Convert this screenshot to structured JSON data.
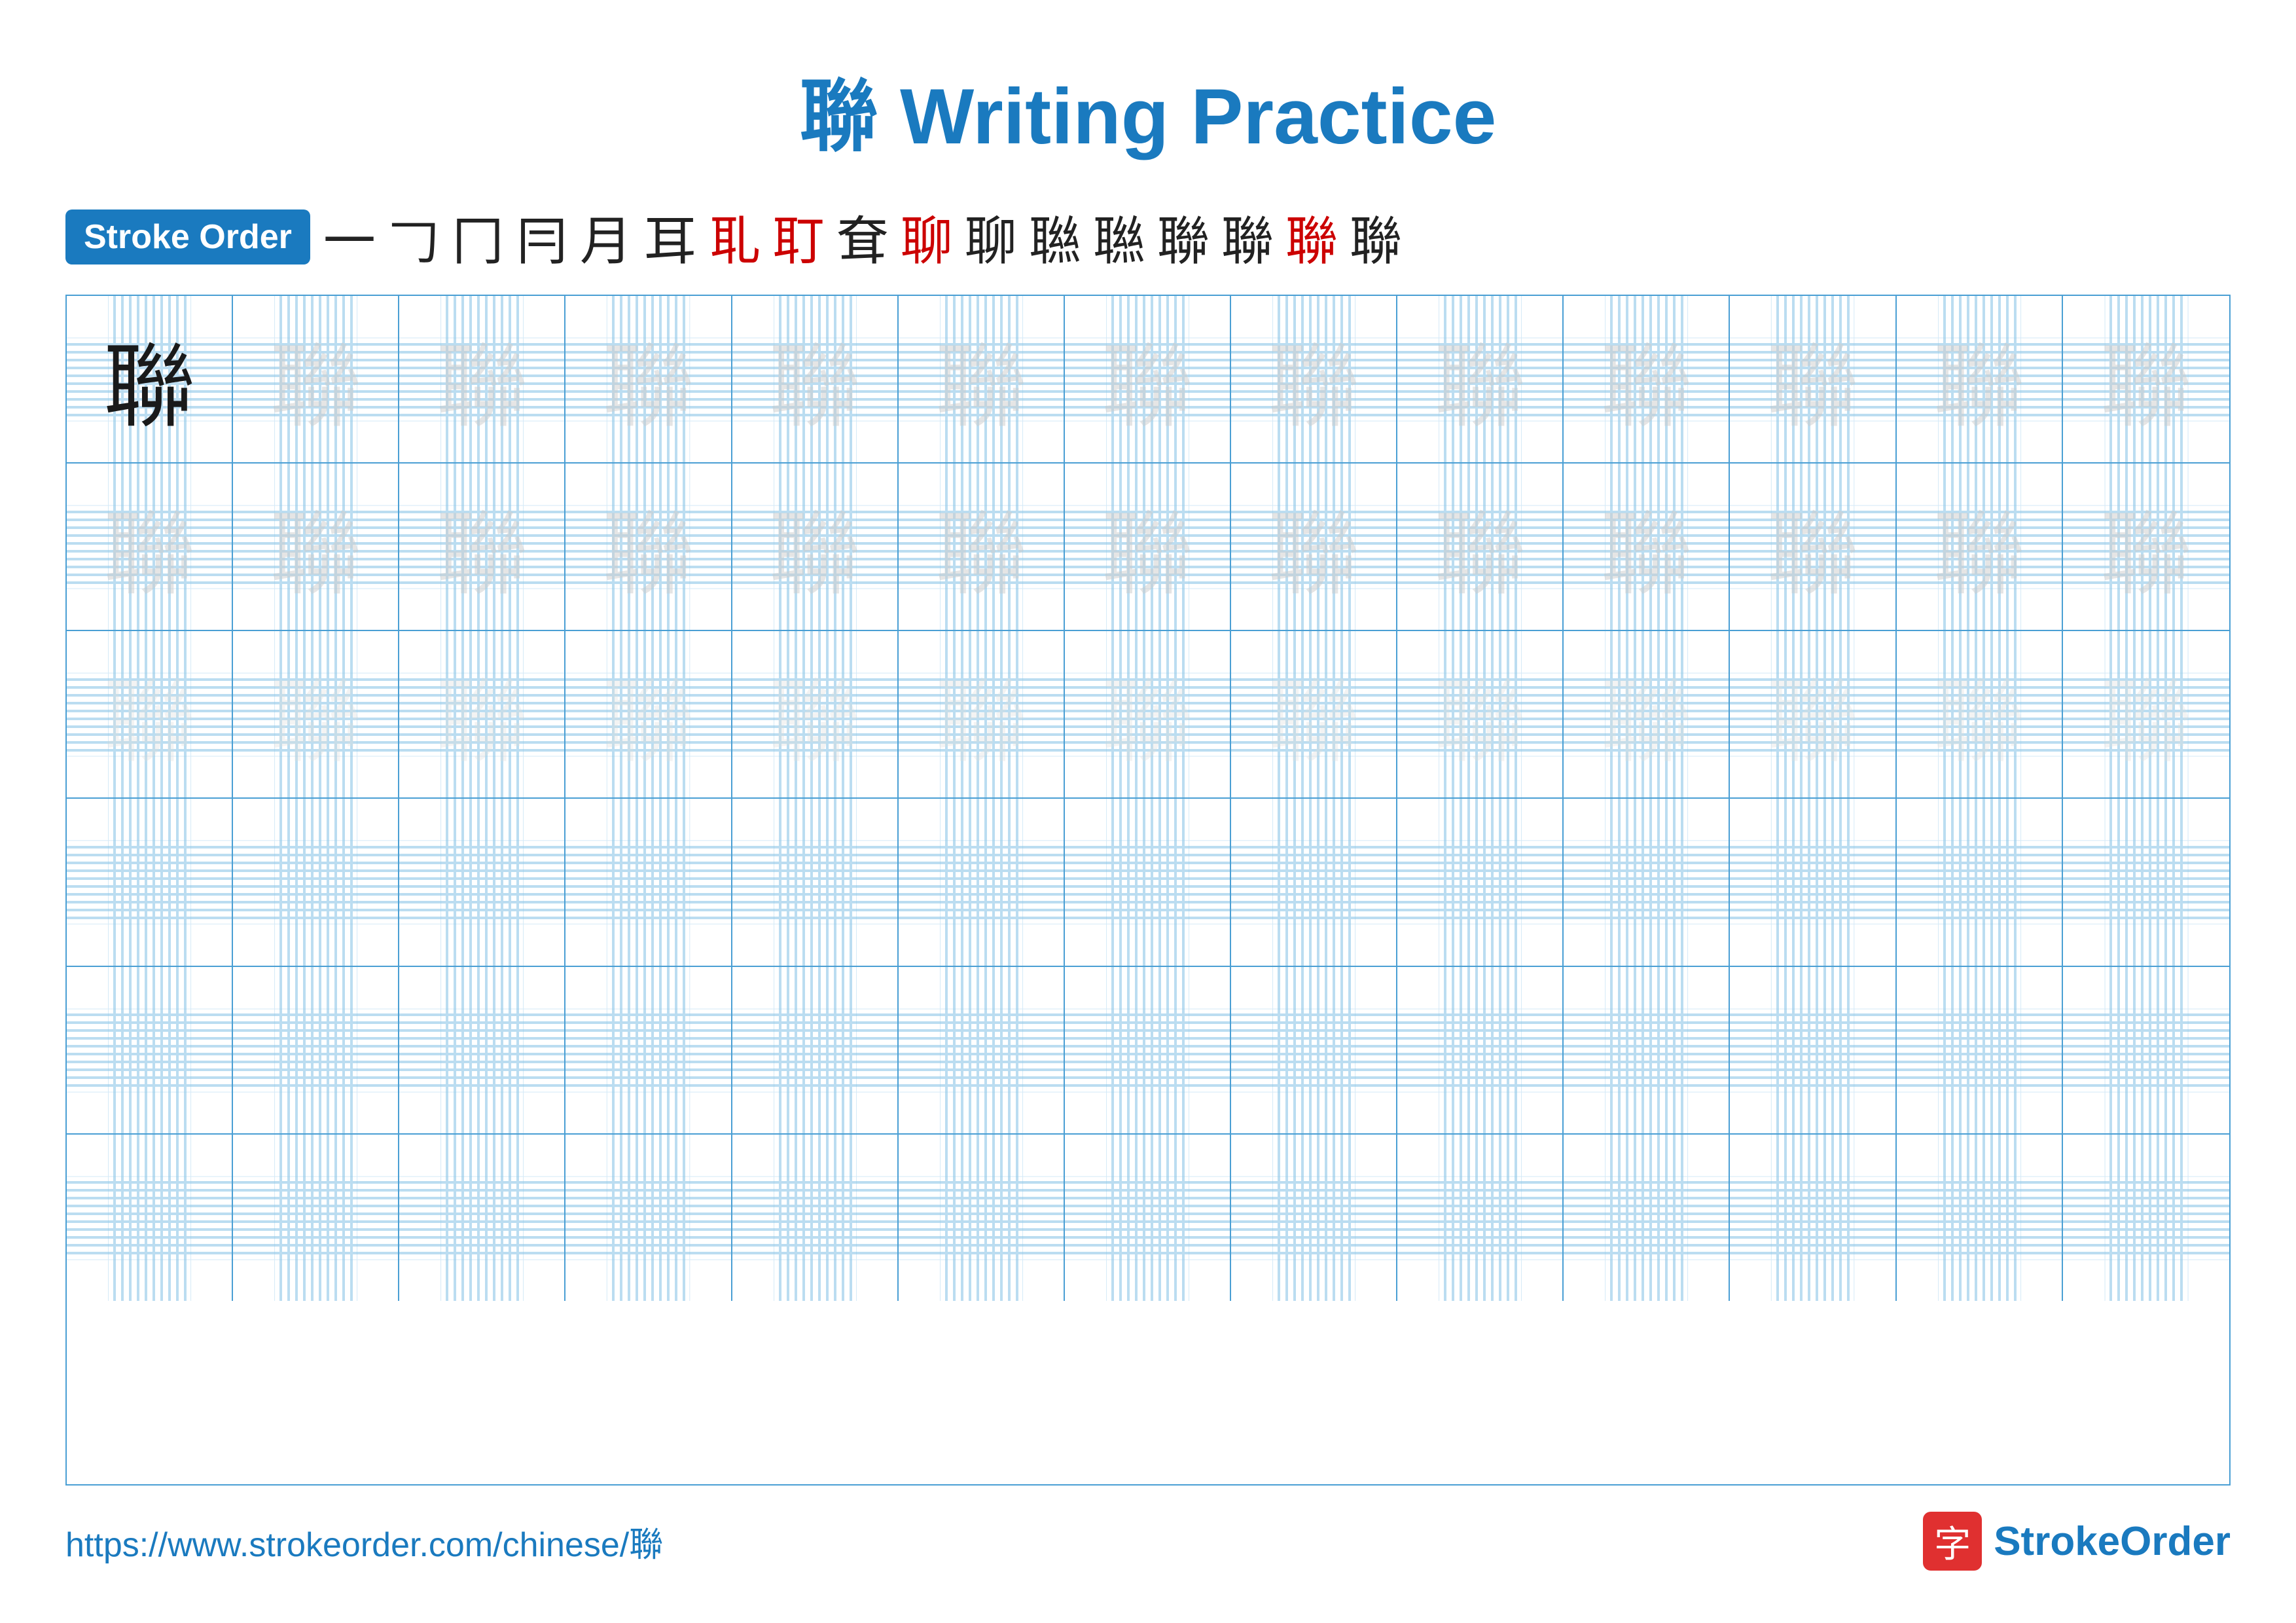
{
  "title": {
    "character": "聯",
    "rest": " Writing Practice"
  },
  "stroke_order": {
    "badge_label": "Stroke Order",
    "strokes": [
      "一",
      "𠃌",
      "冂",
      "冃",
      "月",
      "耳",
      "耴",
      "耵",
      "耶",
      "聊",
      "聊",
      "聮",
      "聮",
      "聯",
      "聯",
      "聯",
      "聯"
    ]
  },
  "grid": {
    "rows": 6,
    "cols": 13,
    "character": "聯",
    "row_configs": [
      {
        "type": "dark_then_light",
        "dark_count": 1
      },
      {
        "type": "all_light"
      },
      {
        "type": "all_lighter"
      },
      {
        "type": "empty"
      },
      {
        "type": "empty"
      },
      {
        "type": "empty"
      }
    ]
  },
  "footer": {
    "url": "https://www.strokeorder.com/chinese/聯",
    "logo_char": "字",
    "logo_name": "StrokeOrder"
  }
}
